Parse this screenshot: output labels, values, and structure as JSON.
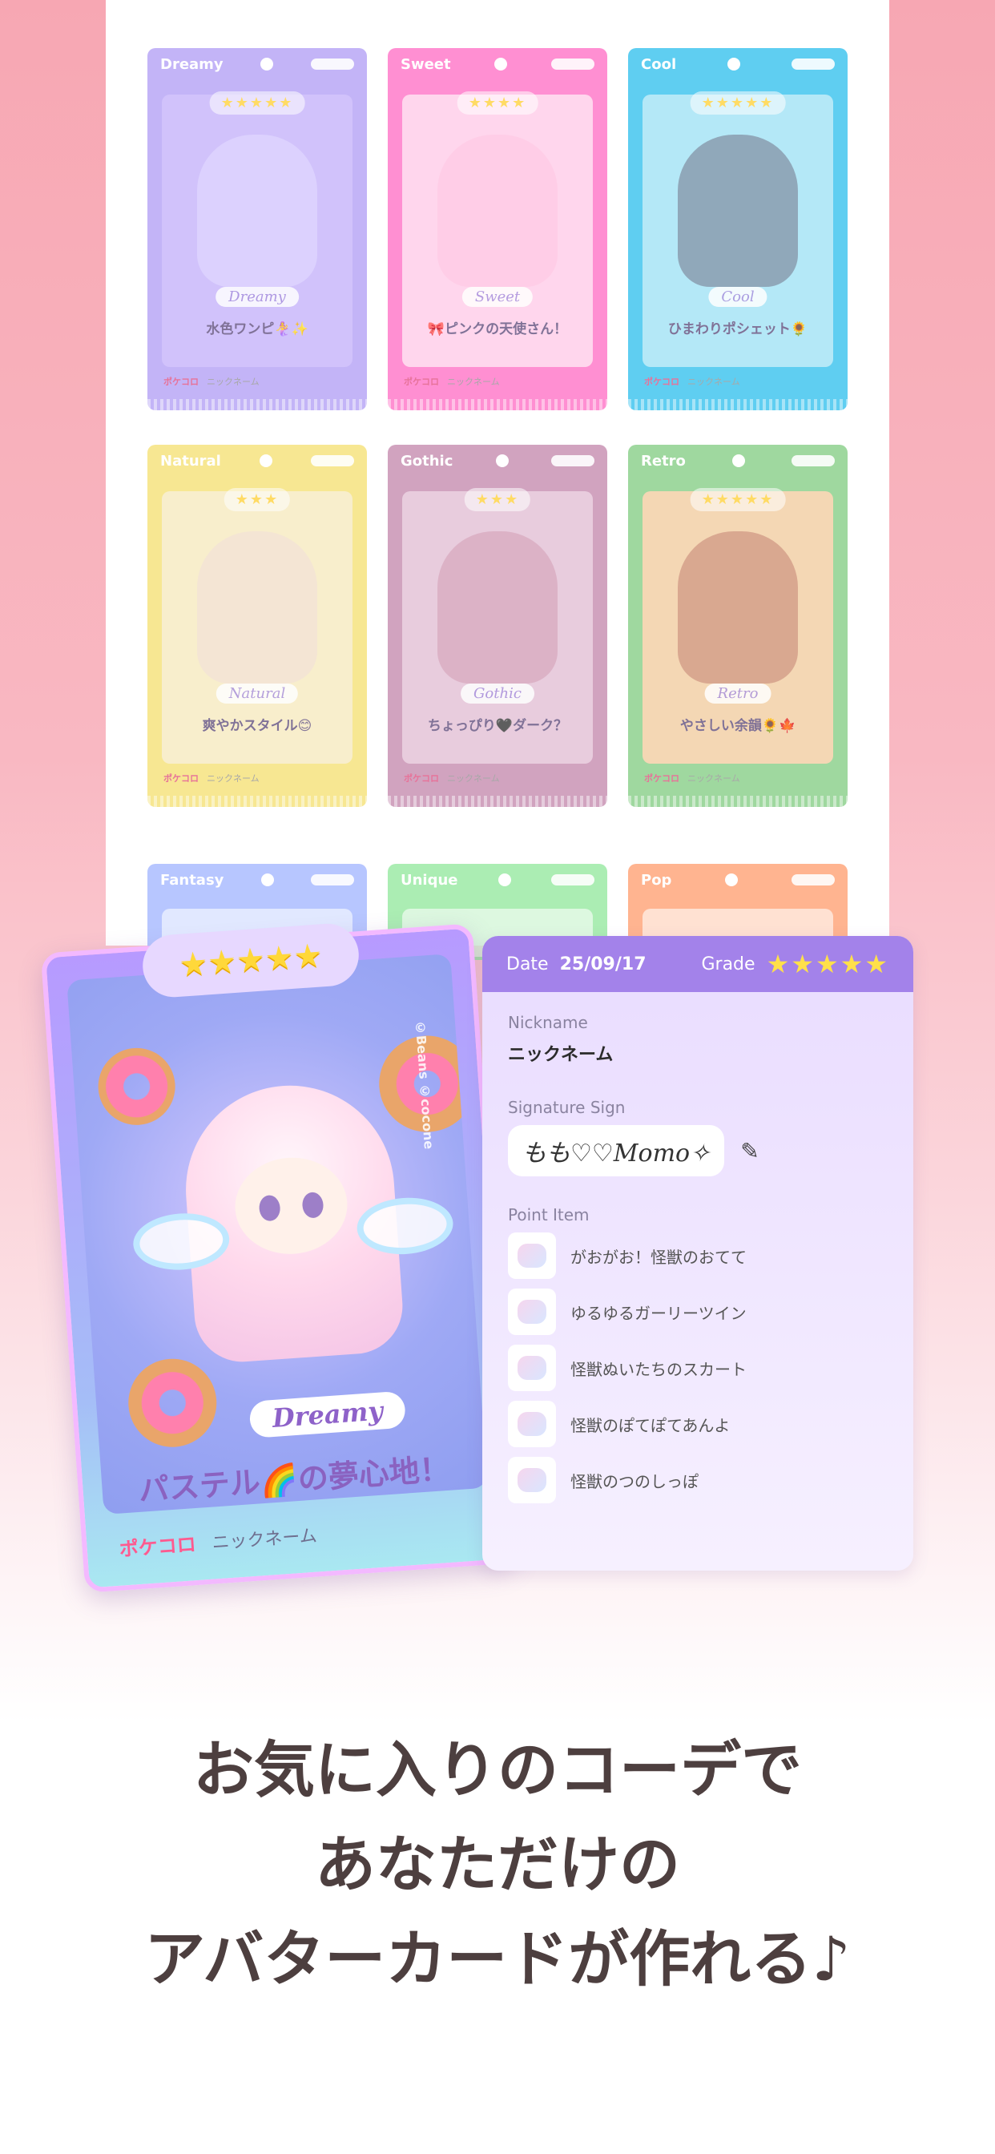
{
  "grid_cards": [
    {
      "theme": "Dreamy",
      "stars": "★★★★★",
      "label": "Dreamy",
      "name": "水色ワンピ🧜‍♀️✨",
      "nick": "ニックネーム",
      "logo": "ポケコロ",
      "color": "#b9a8f6",
      "body": "#c9b8fb",
      "avatar": "#d9cfff"
    },
    {
      "theme": "Sweet",
      "stars": "★★★★",
      "label": "Sweet",
      "name": "🎀ピンクの天使さん！",
      "nick": "ニックネーム",
      "logo": "ポケコロ",
      "color": "#ff7ccb",
      "body": "#ffd0ea",
      "avatar": "#ffc2e0"
    },
    {
      "theme": "Cool",
      "stars": "★★★★★",
      "label": "Cool",
      "name": "ひまわりポシェット🌻",
      "nick": "ニックネーム",
      "logo": "ポケコロ",
      "color": "#44c6ef",
      "body": "#a8e5f6",
      "avatar": "#6f8097"
    },
    {
      "theme": "Natural",
      "stars": "★★★",
      "label": "Natural",
      "name": "爽やかスタイル😊",
      "nick": "ニックネーム",
      "logo": "ポケコロ",
      "color": "#f6e37f",
      "body": "#f7ecc4",
      "avatar": "#f2ddd0"
    },
    {
      "theme": "Gothic",
      "stars": "★★★",
      "label": "Gothic",
      "name": "ちょっぴり🖤ダーク？",
      "nick": "ニックネーム",
      "logo": "ポケコロ",
      "color": "#c993b5",
      "body": "#e4c4d8",
      "avatar": "#d39bb4"
    },
    {
      "theme": "Retro",
      "stars": "★★★★★",
      "label": "Retro",
      "name": "やさしい余韻🌻🍁",
      "nick": "ニックネーム",
      "logo": "ポケコロ",
      "color": "#8fd28f",
      "body": "#f3d1a8",
      "avatar": "#c8866f"
    }
  ],
  "partial_cards": [
    {
      "theme": "Fantasy",
      "color": "#9fb4ff"
    },
    {
      "theme": "Unique",
      "color": "#8fe89a"
    },
    {
      "theme": "Pop",
      "color": "#ff9b6b"
    }
  ],
  "featured_card": {
    "stars": "★★★★★",
    "label": "Dreamy",
    "name": "パステル🌈の夢心地！",
    "logo": "ポケコロ",
    "nick": "ニックネーム",
    "credit": "©Beans ©cocone"
  },
  "info": {
    "date_label": "Date",
    "date_value": "25/09/17",
    "grade_label": "Grade",
    "grade_stars": "★★★★★",
    "nickname_label": "Nickname",
    "nickname_value": "ニックネーム",
    "signature_label": "Signature Sign",
    "signature_value": "もも♡♡Momo✧",
    "point_item_label": "Point Item",
    "items": [
      "がおがお！怪獣のおてて",
      "ゆるゆるガーリーツイン",
      "怪獣ぬいたちのスカート",
      "怪獣のぽてぽてあんよ",
      "怪獣のつのしっぽ"
    ]
  },
  "caption": {
    "line1": "お気に入りのコーデで",
    "line2": "あなただけの",
    "line3": "アバターカードが作れる♪"
  }
}
